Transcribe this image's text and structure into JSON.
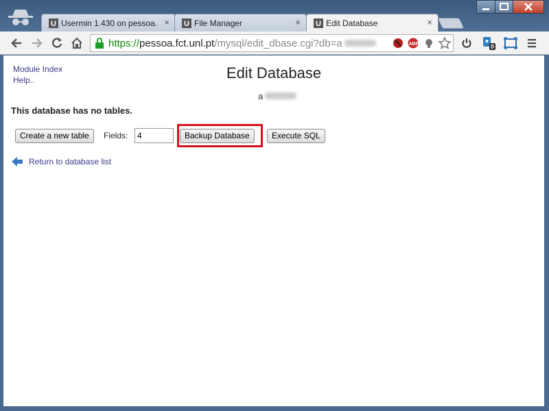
{
  "tabs": [
    {
      "label": "Usermin 1.430 on pessoa.",
      "close": "×"
    },
    {
      "label": "File Manager",
      "close": "×"
    },
    {
      "label": "Edit Database",
      "close": "×"
    }
  ],
  "address": {
    "scheme": "https://",
    "host": "pessoa.fct.unl.pt",
    "path": "/mysql/edit_dbase.cgi?db=a"
  },
  "extension_badge": "0",
  "side_links": {
    "module_index": "Module Index",
    "help": "Help.."
  },
  "page": {
    "title": "Edit Database",
    "db_name_prefix": "a",
    "no_tables": "This database has no tables.",
    "create_table_button": "Create a new table",
    "fields_label": "Fields:",
    "fields_value": "4",
    "backup_button": "Backup Database",
    "execute_sql_button": "Execute SQL",
    "return_link": "Return to database list"
  },
  "colors": {
    "highlight": "#d4101a",
    "link": "#3a3a8a",
    "secure": "#0a8a0a"
  }
}
